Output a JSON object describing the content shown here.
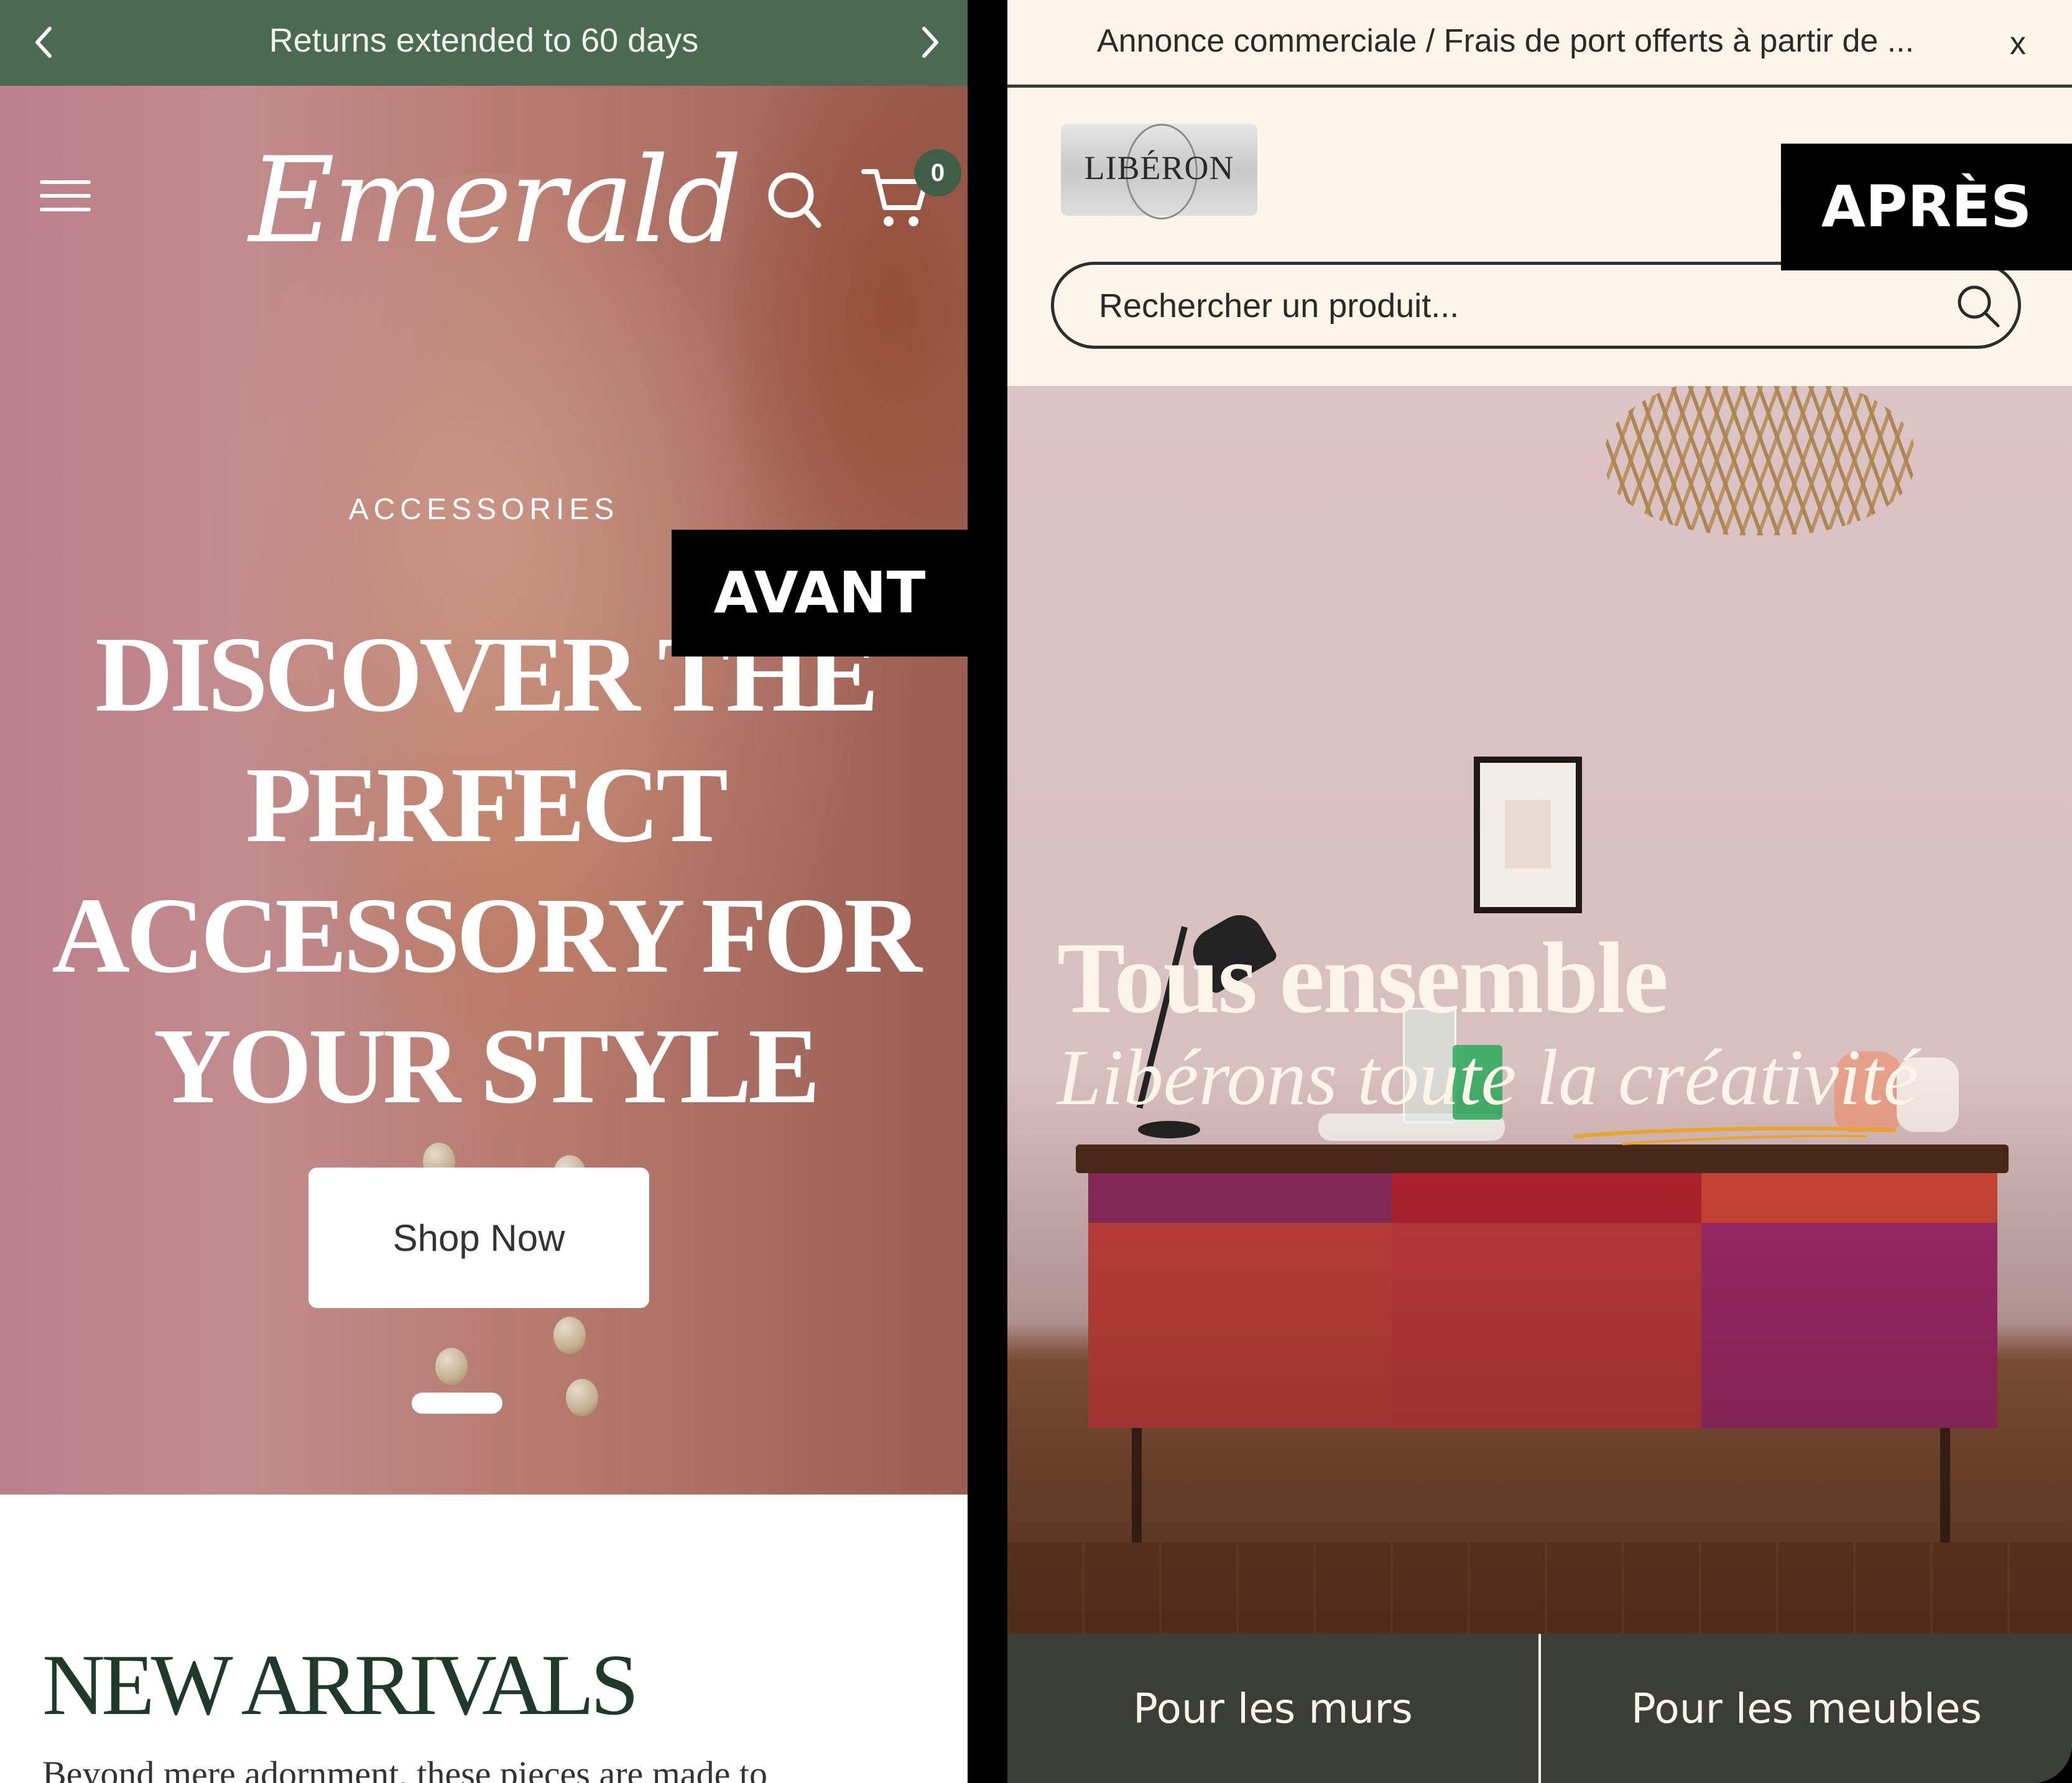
{
  "left": {
    "announcement": "Returns extended to 60 days",
    "brand": "Emerald",
    "cart_count": "0",
    "eyebrow": "ACCESSORIES",
    "headline_lines": [
      "DISCOVER THE",
      "PERFECT",
      "ACCESSORY FOR",
      "YOUR STYLE"
    ],
    "cta": "Shop Now",
    "section_title": "NEW ARRIVALS",
    "section_text": "Beyond mere adornment, these pieces are made to",
    "tag": "AVANT",
    "colors": {
      "announcement_bg": "#4a6a52",
      "badge_bg": "#3f5e47",
      "title": "#1f3a2a"
    }
  },
  "right": {
    "announcement": "Annonce commerciale / Frais de port offerts à partir de ...",
    "close_label": "x",
    "logo_text": "LIBÉRON",
    "search_placeholder": "Rechercher un produit...",
    "headline": "Tous ensemble",
    "subheadline": "Libérons toute la  créativité",
    "tag": "APRÈS",
    "tabs": [
      "Pour les murs",
      "Pour les meubles"
    ],
    "colors": {
      "background": "#fdf4ea",
      "tabs_bg": "#3a3e36",
      "underline": "#e8a52a"
    }
  },
  "icons": [
    "chevron-left-icon",
    "chevron-right-icon",
    "menu-icon",
    "search-icon",
    "cart-icon",
    "user-icon",
    "basket-icon",
    "close-icon"
  ]
}
